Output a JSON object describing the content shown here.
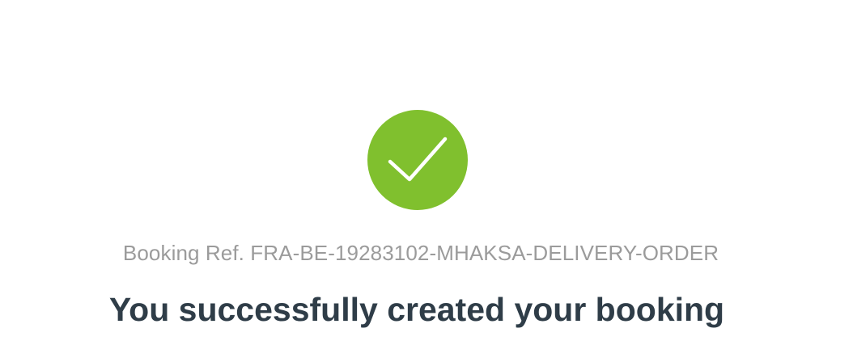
{
  "confirmation": {
    "icon": "checkmark-icon",
    "accent_color": "#80c02e",
    "booking_ref_label": "Booking Ref. FRA-BE-19283102-MHAKSA-DELIVERY-ORDER",
    "title": "You successfully created your booking"
  }
}
